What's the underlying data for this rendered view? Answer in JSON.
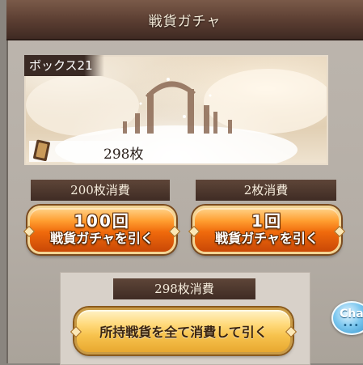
{
  "header": {
    "title": "戦貨ガチャ"
  },
  "box": {
    "label": "ボックス21",
    "count": "298枚"
  },
  "draws": [
    {
      "cost": "200枚消費",
      "line1": "100回",
      "line2": "戦貨ガチャを引く"
    },
    {
      "cost": "2枚消費",
      "line1": "1回",
      "line2": "戦貨ガチャを引く"
    }
  ],
  "draw_all": {
    "cost": "298枚消費",
    "label": "所持戦貨を全て消費して引く"
  },
  "chat": {
    "label": "Chat",
    "dots": "•••"
  },
  "colors": {
    "header": "#5a3d31",
    "orange_button": "#f06a0c",
    "gold_button": "#f7c34e",
    "chat": "#2f8fc8"
  }
}
